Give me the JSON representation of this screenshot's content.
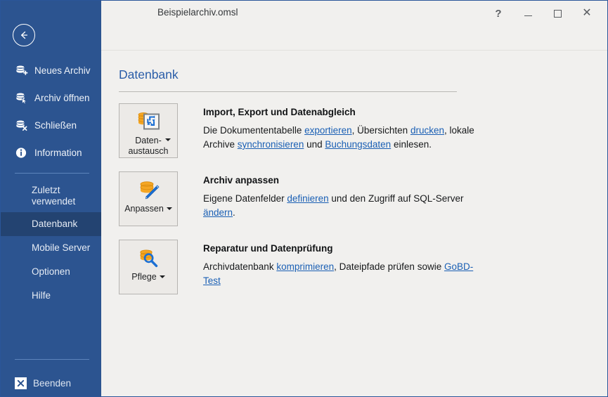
{
  "window": {
    "title": "Beispielarchiv.omsl",
    "controls": [
      {
        "name": "help-button",
        "glyph": "?"
      },
      {
        "name": "minimize-button",
        "glyph": "minimize-icon"
      },
      {
        "name": "maximize-button",
        "glyph": "maximize-icon"
      },
      {
        "name": "close-button",
        "glyph": "close-icon"
      }
    ]
  },
  "colors": {
    "sidebar_bg": "#2c5490",
    "sidebar_selected": "#234371",
    "accent_blue": "#2a5da8",
    "link_blue": "#1a5fb4",
    "content_bg": "#f1f0ee",
    "icon_orange": "#f5a623"
  },
  "sidebar": {
    "back_button": "back-arrow-icon",
    "actions": [
      {
        "label": "Neues Archiv",
        "icon": "database-add-icon"
      },
      {
        "label": "Archiv öffnen",
        "icon": "database-open-icon"
      },
      {
        "label": "Schließen",
        "icon": "database-close-icon"
      },
      {
        "label": "Information",
        "icon": "info-icon"
      }
    ],
    "nav": [
      {
        "label": "Zuletzt",
        "label2": "verwendet",
        "selected": false
      },
      {
        "label": "Datenbank",
        "selected": true
      },
      {
        "label": "Mobile Server",
        "selected": false
      },
      {
        "label": "Optionen",
        "selected": false
      },
      {
        "label": "Hilfe",
        "selected": false
      }
    ],
    "exit": {
      "label": "Beenden",
      "icon": "exit-x-icon"
    }
  },
  "page": {
    "title": "Datenbank",
    "sections": [
      {
        "button": {
          "label_line1": "Daten-",
          "label_line2": "austausch",
          "icon": "data-exchange-icon",
          "has_dropdown": true
        },
        "heading": "Import, Export und Datenabgleich",
        "body": [
          {
            "t": "Die Dokumententabelle ",
            "link": false
          },
          {
            "t": "exportieren",
            "link": true
          },
          {
            "t": ", Übersichten ",
            "link": false
          },
          {
            "t": "drucken",
            "link": true
          },
          {
            "t": ", lokale Archive ",
            "link": false
          },
          {
            "t": "synchronisieren",
            "link": true
          },
          {
            "t": " und ",
            "link": false
          },
          {
            "t": "Buchungsdaten",
            "link": true
          },
          {
            "t": " einlesen.",
            "link": false
          }
        ]
      },
      {
        "button": {
          "label_line1": "Anpassen",
          "label_line2": "",
          "icon": "database-edit-icon",
          "has_dropdown": true
        },
        "heading": "Archiv anpassen",
        "body": [
          {
            "t": "Eigene Datenfelder ",
            "link": false
          },
          {
            "t": "definieren",
            "link": true
          },
          {
            "t": " und den Zugriff auf SQL-Server ",
            "link": false
          },
          {
            "t": "ändern",
            "link": true
          },
          {
            "t": ".",
            "link": false
          }
        ]
      },
      {
        "button": {
          "label_line1": "Pflege",
          "label_line2": "",
          "icon": "database-inspect-icon",
          "has_dropdown": true
        },
        "heading": "Reparatur und Datenprüfung",
        "body": [
          {
            "t": "Archivdatenbank ",
            "link": false
          },
          {
            "t": "komprimieren",
            "link": true
          },
          {
            "t": ", Dateipfade prüfen sowie ",
            "link": false
          },
          {
            "t": "GoBD-Test",
            "link": true
          }
        ]
      }
    ]
  }
}
